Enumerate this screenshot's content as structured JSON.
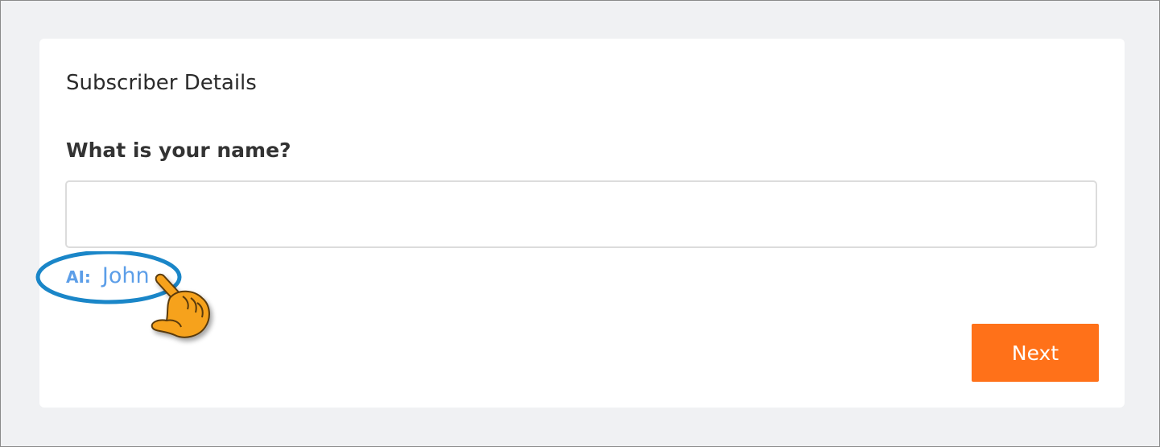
{
  "form": {
    "section_title": "Subscriber Details",
    "question": "What is your name?",
    "name_input": {
      "value": "",
      "placeholder": ""
    },
    "ai_suggestion": {
      "prefix": "AI:",
      "value": "John"
    },
    "next_label": "Next"
  },
  "colors": {
    "accent_orange": "#ff7119",
    "ai_blue": "#5c9ee8",
    "highlight_ring": "#1a86c8",
    "pointer_hand": "#f6a21c"
  },
  "annotations": {
    "highlight_icon": "ellipse-highlight",
    "pointer_icon": "pointing-hand-icon"
  }
}
